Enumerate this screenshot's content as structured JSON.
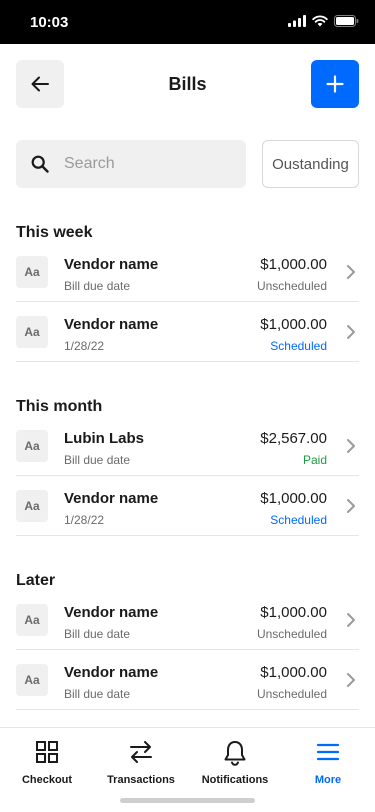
{
  "status_bar": {
    "time": "10:03"
  },
  "header": {
    "title": "Bills"
  },
  "search": {
    "placeholder": "Search",
    "value": ""
  },
  "filter": {
    "label": "Oustanding"
  },
  "colors": {
    "accent": "#006aff",
    "paid": "#1a9e3f",
    "scheduled": "#006aff",
    "unscheduled": "#6b6b6b"
  },
  "sections": [
    {
      "title": "This week",
      "items": [
        {
          "avatar": "Aa",
          "name": "Vendor name",
          "sub": "Bill due date",
          "amount": "$1,000.00",
          "status": "Unscheduled",
          "status_type": "unscheduled"
        },
        {
          "avatar": "Aa",
          "name": "Vendor name",
          "sub": "1/28/22",
          "amount": "$1,000.00",
          "status": "Scheduled",
          "status_type": "scheduled"
        }
      ]
    },
    {
      "title": "This month",
      "items": [
        {
          "avatar": "Aa",
          "name": "Lubin Labs",
          "sub": "Bill due date",
          "amount": "$2,567.00",
          "status": "Paid",
          "status_type": "paid"
        },
        {
          "avatar": "Aa",
          "name": "Vendor name",
          "sub": "1/28/22",
          "amount": "$1,000.00",
          "status": "Scheduled",
          "status_type": "scheduled"
        }
      ]
    },
    {
      "title": "Later",
      "items": [
        {
          "avatar": "Aa",
          "name": "Vendor name",
          "sub": "Bill due date",
          "amount": "$1,000.00",
          "status": "Unscheduled",
          "status_type": "unscheduled"
        },
        {
          "avatar": "Aa",
          "name": "Vendor name",
          "sub": "Bill due date",
          "amount": "$1,000.00",
          "status": "Unscheduled",
          "status_type": "unscheduled"
        }
      ]
    }
  ],
  "tab_bar": {
    "tabs": [
      {
        "label": "Checkout",
        "icon": "grid-icon"
      },
      {
        "label": "Transactions",
        "icon": "arrows-icon"
      },
      {
        "label": "Notifications",
        "icon": "bell-icon"
      },
      {
        "label": "More",
        "icon": "menu-icon",
        "active": true
      }
    ]
  }
}
